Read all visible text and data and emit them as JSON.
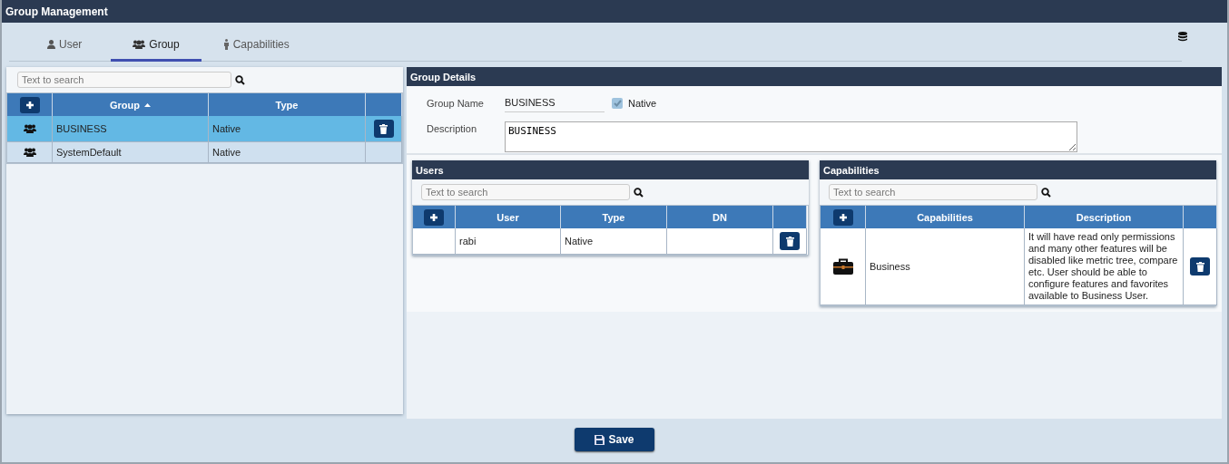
{
  "window": {
    "title": "Group Management"
  },
  "tabs": [
    {
      "label": "User",
      "kind": "user",
      "selected": false
    },
    {
      "label": "Group",
      "kind": "group",
      "selected": true
    },
    {
      "label": "Capabilities",
      "kind": "capability",
      "selected": false
    }
  ],
  "groups": {
    "search": {
      "placeholder": "Text to search"
    },
    "columns": [
      {
        "label": "Group",
        "sorted": true
      },
      {
        "label": "Type",
        "sorted": false
      }
    ],
    "rows": [
      {
        "name": "BUSINESS",
        "type": "Native",
        "selected": true
      },
      {
        "name": "SystemDefault",
        "type": "Native",
        "selected": false
      }
    ]
  },
  "details": {
    "title": "Group Details",
    "name_label": "Group Name",
    "name_value": "BUSINESS",
    "native": {
      "label": "Native",
      "checked": true
    },
    "description_label": "Description",
    "description_value": "BUSINESS"
  },
  "users": {
    "title": "Users",
    "search": {
      "placeholder": "Text to search"
    },
    "columns": [
      "User",
      "Type",
      "DN"
    ],
    "rows": [
      {
        "user": "rabi",
        "type": "Native"
      }
    ]
  },
  "capabilities": {
    "title": "Capabilities",
    "search": {
      "placeholder": "Text to search"
    },
    "columns": [
      "Capabilities",
      "Description"
    ],
    "rows": [
      {
        "name": "Business",
        "description": "It will have read only permissions and many other features will be disabled like metric tree, compare etc. User should be able to configure features and favorites available to Business User."
      }
    ]
  },
  "save_label": "Save"
}
